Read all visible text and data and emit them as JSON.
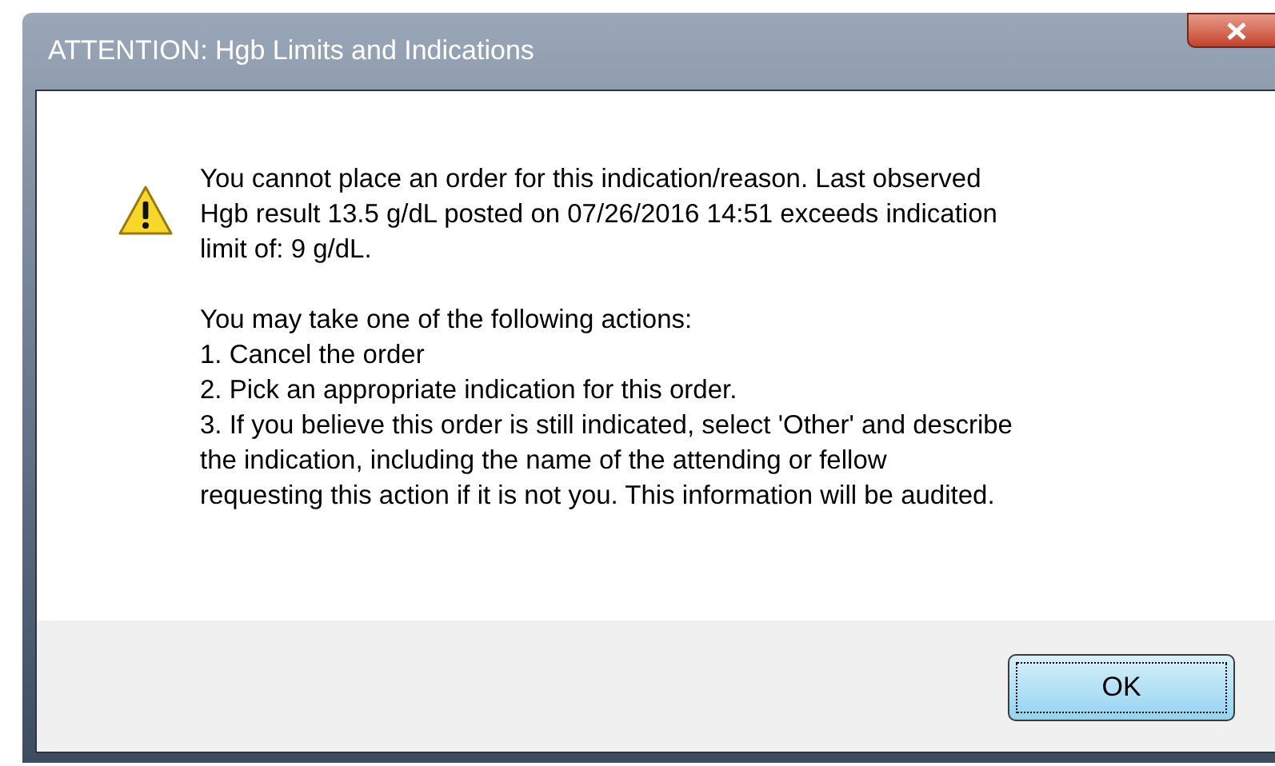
{
  "window": {
    "title": "ATTENTION: Hgb Limits and Indications"
  },
  "message": {
    "paragraphs": [
      [
        "You cannot place an order for this indication/reason.  Last observed",
        "Hgb result 13.5 g/dL posted on 07/26/2016 14:51 exceeds indication",
        "limit of: 9 g/dL."
      ],
      [
        "You may take one of the following actions:",
        "1. Cancel the order",
        "2. Pick an appropriate indication for this order.",
        "3. If you believe this order is still indicated, select 'Other' and describe",
        "the indication, including the name of the attending or fellow",
        "requesting this action if it is not you. This information will be audited."
      ]
    ]
  },
  "buttons": [
    {
      "label": "OK",
      "selected": true
    }
  ]
}
